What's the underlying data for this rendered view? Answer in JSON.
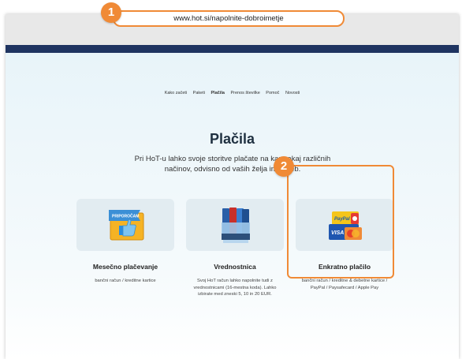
{
  "browser": {
    "url": "www.hot.si/napolnite-dobroimetje"
  },
  "callouts": [
    "1",
    "2"
  ],
  "menu": {
    "items": [
      "Kako začeti",
      "Paketi",
      "Plačila",
      "Prenos številke",
      "Pomoč",
      "Novosti"
    ],
    "active": "Plačila"
  },
  "page": {
    "title": "Plačila",
    "lead": "Pri HoT-u lahko svoje storitve plačate na kar nekaj različnih načinov, odvisno od vaših želja in potreb."
  },
  "cards": [
    {
      "title": "Mesečno plačevanje",
      "description": "bančni račun / kreditne kartice",
      "icon_badge": "PRIPOROČAM"
    },
    {
      "title": "Vrednostnica",
      "description": "Svoj HoT račun lahko napolnite tudi z vrednostnicami (16-mestna koda). Lahko izbirate med zneski 5, 10 in 20 EUR."
    },
    {
      "title": "Enkratno plačilo",
      "description": "bančni račun / kreditne & debetne kartice / PayPal / Paysafecard / Apple Pay",
      "icon_labels": {
        "paypal": "PayPal",
        "visa": "VISA",
        "mastercard": "MasterCard"
      }
    }
  ],
  "colors": {
    "accent": "#f08a36",
    "navbar": "#1f3461",
    "card_bg": "#e2ecf1"
  }
}
